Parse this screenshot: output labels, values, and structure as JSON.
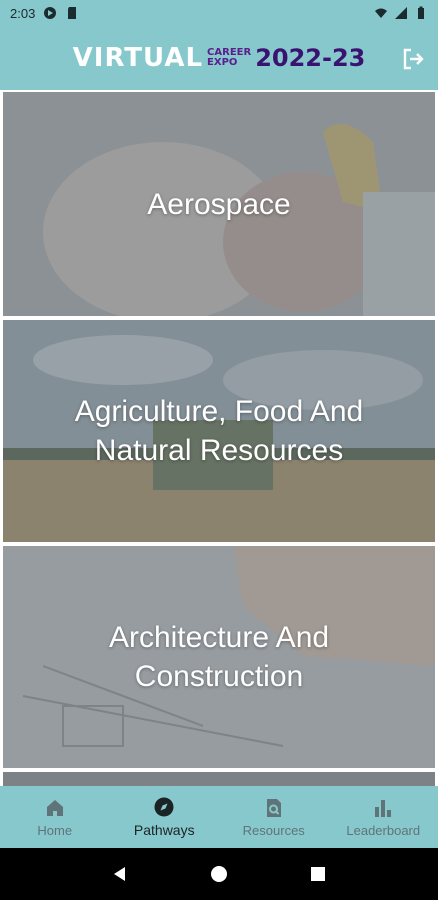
{
  "status_bar": {
    "time": "2:03"
  },
  "app_bar": {
    "logo_virtual": "VIRTUAL",
    "logo_career": "CAREER",
    "logo_expo": "EXPO",
    "logo_year": "2022-23",
    "logout_icon": "logout-icon"
  },
  "pathways": [
    {
      "label": "Aerospace",
      "image": "hand-holding-model-airplane"
    },
    {
      "label": "Agriculture, Food And Natural Resources",
      "image": "combine-harvester-wheat-field"
    },
    {
      "label": "Architecture And Construction",
      "image": "hand-drawing-blueprint"
    }
  ],
  "bottom_nav": [
    {
      "label": "Home",
      "icon": "home-icon",
      "active": false
    },
    {
      "label": "Pathways",
      "icon": "compass-icon",
      "active": true
    },
    {
      "label": "Resources",
      "icon": "resources-search-icon",
      "active": false
    },
    {
      "label": "Leaderboard",
      "icon": "bar-chart-icon",
      "active": false
    }
  ],
  "colors": {
    "accent": "#86c8cc",
    "logo_purple": "#3a1270"
  }
}
